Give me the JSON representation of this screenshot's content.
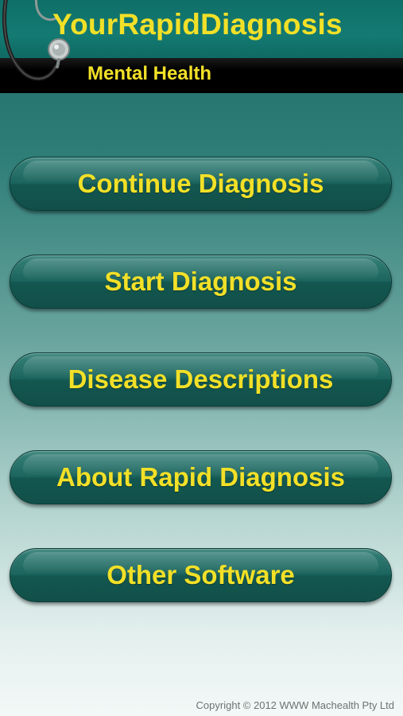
{
  "header": {
    "title": "YourRapidDiagnosis",
    "subtitle": "Mental Health",
    "logo_icon": "stethoscope-icon"
  },
  "colors": {
    "accent_text": "#f2e028",
    "button_green": "#1c655e",
    "header_band": "#000000"
  },
  "menu": {
    "items": [
      {
        "label": "Continue Diagnosis"
      },
      {
        "label": "Start Diagnosis"
      },
      {
        "label": "Disease Descriptions"
      },
      {
        "label": "About Rapid Diagnosis"
      },
      {
        "label": "Other Software"
      }
    ]
  },
  "footer": {
    "copyright": "Copyright © 2012 WWW Machealth Pty Ltd"
  }
}
